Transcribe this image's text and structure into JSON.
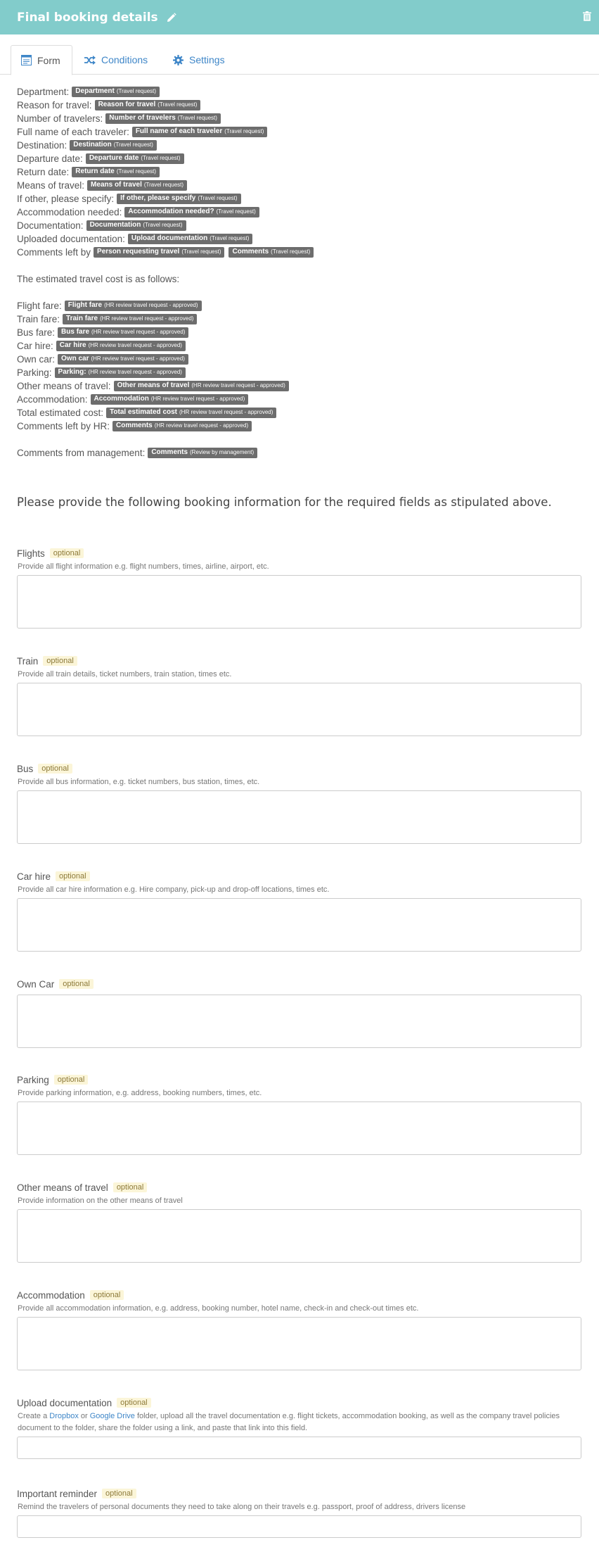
{
  "header": {
    "title": "Final booking details"
  },
  "tabs": [
    {
      "label": "Form"
    },
    {
      "label": "Conditions"
    },
    {
      "label": "Settings"
    }
  ],
  "colors": {
    "header": "#82cccb",
    "link": "#3e86c8",
    "tag": "#6d6d6d",
    "badge_bg": "#fbf5d8"
  },
  "summary": {
    "travel": [
      {
        "label": "Department:",
        "tags": [
          {
            "name": "Department",
            "source": "(Travel request)"
          }
        ]
      },
      {
        "label": "Reason for travel:",
        "tags": [
          {
            "name": "Reason for travel",
            "source": "(Travel request)"
          }
        ]
      },
      {
        "label": "Number of travelers:",
        "tags": [
          {
            "name": "Number of travelers",
            "source": "(Travel request)"
          }
        ]
      },
      {
        "label": "Full name of each traveler:",
        "tags": [
          {
            "name": "Full name of each traveler",
            "source": "(Travel request)"
          }
        ]
      },
      {
        "label": "Destination:",
        "tags": [
          {
            "name": "Destination",
            "source": "(Travel request)"
          }
        ]
      },
      {
        "label": "Departure date:",
        "tags": [
          {
            "name": "Departure date",
            "source": "(Travel request)"
          }
        ]
      },
      {
        "label": "Return date:",
        "tags": [
          {
            "name": "Return date",
            "source": "(Travel request)"
          }
        ]
      },
      {
        "label": "Means of travel:",
        "tags": [
          {
            "name": "Means of travel",
            "source": "(Travel request)"
          }
        ]
      },
      {
        "label": "If other, please specify:",
        "tags": [
          {
            "name": "If other, please specify",
            "source": "(Travel request)"
          }
        ]
      },
      {
        "label": "Accommodation needed:",
        "tags": [
          {
            "name": "Accommodation needed?",
            "source": "(Travel request)"
          }
        ]
      },
      {
        "label": "Documentation:",
        "tags": [
          {
            "name": "Documentation",
            "source": "(Travel request)"
          }
        ]
      },
      {
        "label": "Uploaded documentation:",
        "tags": [
          {
            "name": "Upload documentation",
            "source": "(Travel request)"
          }
        ]
      },
      {
        "label": "Comments left by",
        "tags": [
          {
            "name": "Person requesting travel",
            "source": "(Travel request)"
          },
          {
            "name": "Comments",
            "source": "(Travel request)"
          }
        ]
      }
    ],
    "cost_intro": "The estimated travel cost is as follows:",
    "costs": [
      {
        "label": "Flight fare:",
        "tags": [
          {
            "name": "Flight fare",
            "source": "(HR review travel request - approved)"
          }
        ]
      },
      {
        "label": "Train fare:",
        "tags": [
          {
            "name": "Train fare",
            "source": "(HR review travel request - approved)"
          }
        ]
      },
      {
        "label": "Bus fare:",
        "tags": [
          {
            "name": "Bus fare",
            "source": "(HR review travel request - approved)"
          }
        ]
      },
      {
        "label": "Car hire:",
        "tags": [
          {
            "name": "Car hire",
            "source": "(HR review travel request - approved)"
          }
        ]
      },
      {
        "label": "Own car:",
        "tags": [
          {
            "name": "Own car",
            "source": "(HR review travel request - approved)"
          }
        ]
      },
      {
        "label": "Parking:",
        "tags": [
          {
            "name": "Parking:",
            "source": "(HR review travel request - approved)"
          }
        ]
      },
      {
        "label": "Other means of travel:",
        "tags": [
          {
            "name": "Other means of travel",
            "source": "(HR review travel request - approved)"
          }
        ]
      },
      {
        "label": "Accommodation:",
        "tags": [
          {
            "name": "Accommodation",
            "source": "(HR review travel request - approved)"
          }
        ]
      },
      {
        "label": "Total estimated cost:",
        "tags": [
          {
            "name": "Total estimated cost",
            "source": "(HR review travel request - approved)"
          }
        ]
      },
      {
        "label": "Comments left by HR:",
        "tags": [
          {
            "name": "Comments",
            "source": "(HR review travel request - approved)"
          }
        ]
      }
    ],
    "management": [
      {
        "label": "Comments from management:",
        "tags": [
          {
            "name": "Comments",
            "source": "(Review by management)"
          }
        ]
      }
    ]
  },
  "heading": "Please provide the following booking information for the required fields as stipulated above.",
  "optional_label": "optional",
  "fields": {
    "flights": {
      "label": "Flights",
      "desc": "Provide all flight information e.g. flight numbers, times, airline, airport, etc."
    },
    "train": {
      "label": "Train",
      "desc": "Provide all train details, ticket numbers, train station, times etc."
    },
    "bus": {
      "label": "Bus",
      "desc": "Provide all bus information, e.g. ticket numbers, bus station, times, etc."
    },
    "car_hire": {
      "label": "Car hire",
      "desc": "Provide all car hire information e.g. Hire company, pick-up and drop-off locations, times etc."
    },
    "own_car": {
      "label": "Own Car"
    },
    "parking": {
      "label": "Parking",
      "desc": "Provide parking information, e.g. address, booking numbers, times, etc."
    },
    "other": {
      "label": "Other means of travel",
      "desc": "Provide information on the other means of travel"
    },
    "accommodation": {
      "label": "Accommodation",
      "desc": "Provide all accommodation information, e.g. address, booking number, hotel name, check-in and check-out times etc."
    },
    "upload": {
      "label": "Upload documentation",
      "desc_part1": "Create a ",
      "link1": "Dropbox",
      "desc_part2": " or ",
      "link2": "Google Drive",
      "desc_part3": " folder, upload all the travel documentation e.g. flight tickets, accommodation booking, as well as the company travel policies document to the folder, share the folder using a link, and paste that link into this field."
    },
    "reminder": {
      "label": "Important reminder",
      "desc": "Remind the travelers of personal documents they need to take along on their travels e.g. passport, proof of address, drivers license"
    }
  }
}
